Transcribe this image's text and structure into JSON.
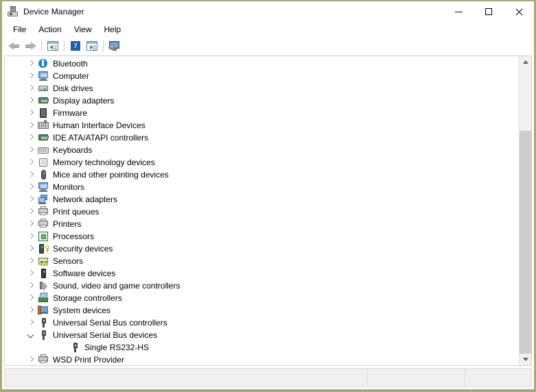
{
  "window": {
    "title": "Device Manager",
    "icon": "device-manager-icon",
    "border_color": "#a9a978",
    "controls": {
      "minimize": "—",
      "maximize": "□",
      "close": "✕"
    }
  },
  "menubar": {
    "items": [
      {
        "label": "File"
      },
      {
        "label": "Action"
      },
      {
        "label": "View"
      },
      {
        "label": "Help"
      }
    ]
  },
  "toolbar": {
    "buttons": [
      {
        "name": "back-button",
        "icon": "back-arrow-icon",
        "enabled": false
      },
      {
        "name": "forward-button",
        "icon": "forward-arrow-icon",
        "enabled": false
      },
      {
        "name": "properties-button",
        "icon": "properties-window-icon"
      },
      {
        "name": "help-button",
        "icon": "help-question-icon",
        "glyph": "?"
      },
      {
        "name": "update-driver-button",
        "icon": "scan-window-icon"
      },
      {
        "name": "scan-hardware-button",
        "icon": "scan-monitor-icon"
      }
    ]
  },
  "tree": {
    "nodes": [
      {
        "label": "Bluetooth",
        "icon": "bluetooth-icon",
        "state": "collapsed",
        "level": 1
      },
      {
        "label": "Computer",
        "icon": "computer-monitor-icon",
        "state": "collapsed",
        "level": 1
      },
      {
        "label": "Disk drives",
        "icon": "disk-drive-icon",
        "state": "collapsed",
        "level": 1
      },
      {
        "label": "Display adapters",
        "icon": "display-adapter-icon",
        "state": "collapsed",
        "level": 1
      },
      {
        "label": "Firmware",
        "icon": "firmware-chip-icon",
        "state": "collapsed",
        "level": 1
      },
      {
        "label": "Human Interface Devices",
        "icon": "human-interface-device-icon",
        "state": "collapsed",
        "level": 1
      },
      {
        "label": "IDE ATA/ATAPI controllers",
        "icon": "ide-controller-icon",
        "state": "collapsed",
        "level": 1
      },
      {
        "label": "Keyboards",
        "icon": "keyboard-icon",
        "state": "collapsed",
        "level": 1
      },
      {
        "label": "Memory technology devices",
        "icon": "memory-device-icon",
        "state": "collapsed",
        "level": 1
      },
      {
        "label": "Mice and other pointing devices",
        "icon": "mouse-icon",
        "state": "collapsed",
        "level": 1
      },
      {
        "label": "Monitors",
        "icon": "monitor-icon",
        "state": "collapsed",
        "level": 1
      },
      {
        "label": "Network adapters",
        "icon": "network-adapter-icon",
        "state": "collapsed",
        "level": 1
      },
      {
        "label": "Print queues",
        "icon": "printer-icon",
        "state": "collapsed",
        "level": 1
      },
      {
        "label": "Printers",
        "icon": "printer-icon",
        "state": "collapsed",
        "level": 1
      },
      {
        "label": "Processors",
        "icon": "processor-chip-icon",
        "state": "collapsed",
        "level": 1
      },
      {
        "label": "Security devices",
        "icon": "security-key-icon",
        "state": "collapsed",
        "level": 1
      },
      {
        "label": "Sensors",
        "icon": "sensor-icon",
        "state": "collapsed",
        "level": 1
      },
      {
        "label": "Software devices",
        "icon": "software-device-icon",
        "state": "collapsed",
        "level": 1
      },
      {
        "label": "Sound, video and game controllers",
        "icon": "speaker-icon",
        "state": "collapsed",
        "level": 1
      },
      {
        "label": "Storage controllers",
        "icon": "storage-controller-icon",
        "state": "collapsed",
        "level": 1
      },
      {
        "label": "System devices",
        "icon": "system-device-icon",
        "state": "collapsed",
        "level": 1
      },
      {
        "label": "Universal Serial Bus controllers",
        "icon": "usb-icon",
        "state": "collapsed",
        "level": 1
      },
      {
        "label": "Universal Serial Bus devices",
        "icon": "usb-icon",
        "state": "expanded",
        "level": 1
      },
      {
        "label": "Single RS232-HS",
        "icon": "usb-icon",
        "state": "leaf",
        "level": 2
      },
      {
        "label": "WSD Print Provider",
        "icon": "wsd-print-provider-icon",
        "state": "collapsed",
        "level": 1
      }
    ]
  },
  "scrollbar": {
    "up_arrow": "scroll-up-arrow",
    "down_arrow": "scroll-down-arrow",
    "thumb_top_percent": 22,
    "thumb_height_percent": 78
  },
  "statusbar": {
    "pane1": "",
    "pane2": "",
    "pane3": ""
  }
}
